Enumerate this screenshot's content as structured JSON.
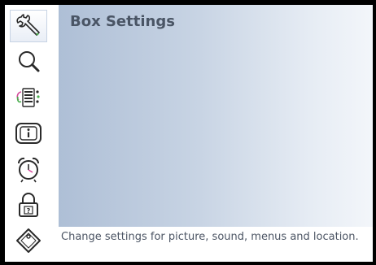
{
  "panel": {
    "title": "Box Settings"
  },
  "description": "Change settings for picture, sound, menus and location.",
  "menu": {
    "items": [
      {
        "icon": "wrench-icon",
        "selected": true
      },
      {
        "icon": "search-icon",
        "selected": false
      },
      {
        "icon": "channel-list-icon",
        "selected": false
      },
      {
        "icon": "info-icon",
        "selected": false
      },
      {
        "icon": "alarm-clock-icon",
        "selected": false
      },
      {
        "icon": "padlock-icon",
        "selected": false
      },
      {
        "icon": "tag-icon",
        "selected": false
      }
    ]
  },
  "colors": {
    "icon_outline": "#2a2a2a",
    "accent_green": "#4caf50",
    "panel_gradient_start": "#aebfd6",
    "panel_gradient_end": "#f3f6fa",
    "text": "#4a5565"
  }
}
